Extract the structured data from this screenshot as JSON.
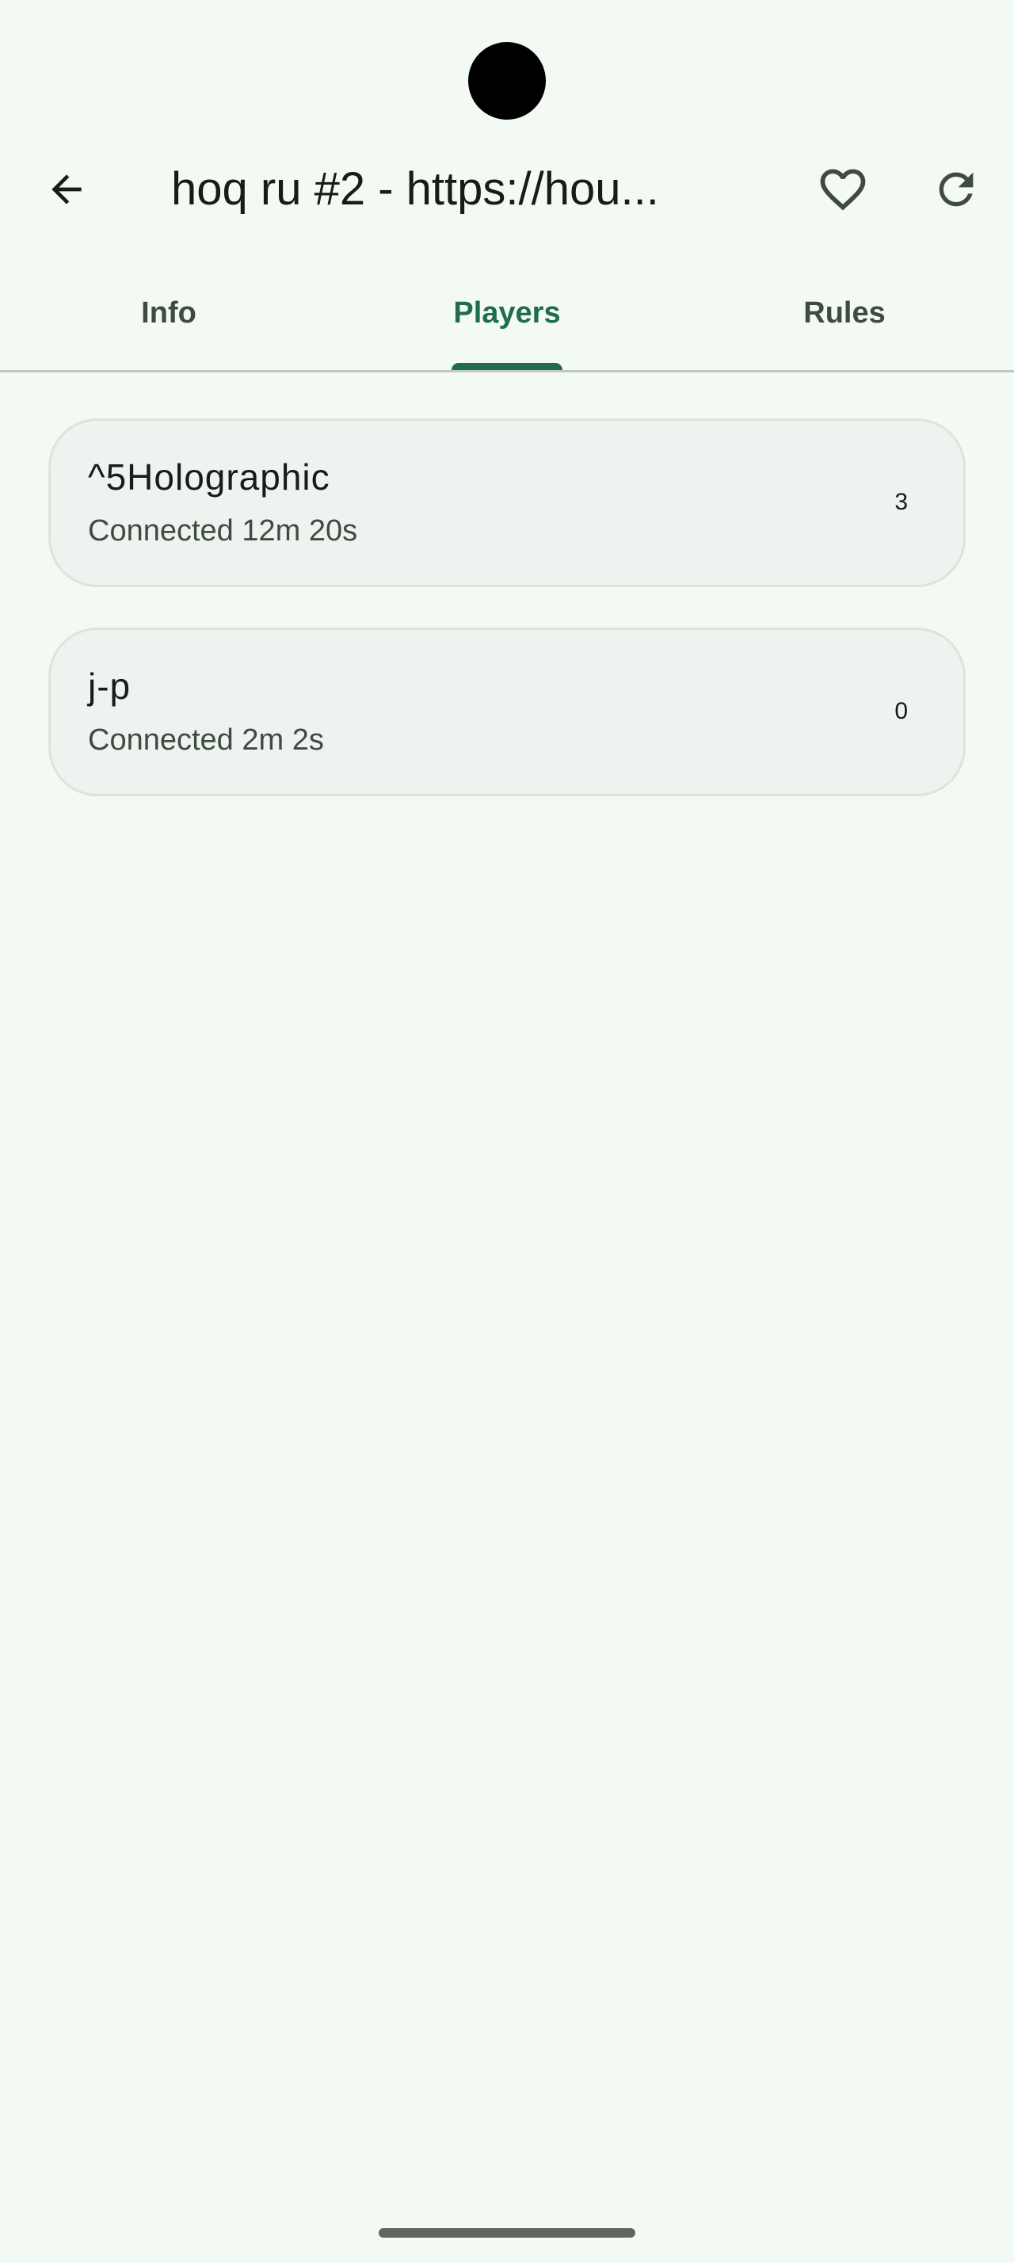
{
  "app_bar": {
    "title": "hoq ru #2 - https://hou...",
    "back_icon": "arrow-back-icon",
    "favorite_icon": "heart-outline-icon",
    "refresh_icon": "refresh-icon"
  },
  "tabs": [
    {
      "label": "Info",
      "selected": false
    },
    {
      "label": "Players",
      "selected": true
    },
    {
      "label": "Rules",
      "selected": false
    }
  ],
  "players": [
    {
      "name": "^5Holographic",
      "status": "Connected 12m 20s",
      "score": "3"
    },
    {
      "name": "j-p",
      "status": "Connected 2m 2s",
      "score": "0"
    }
  ],
  "colors": {
    "background": "#f3faf4",
    "accent": "#216c4f",
    "card": "#edf3ee"
  }
}
